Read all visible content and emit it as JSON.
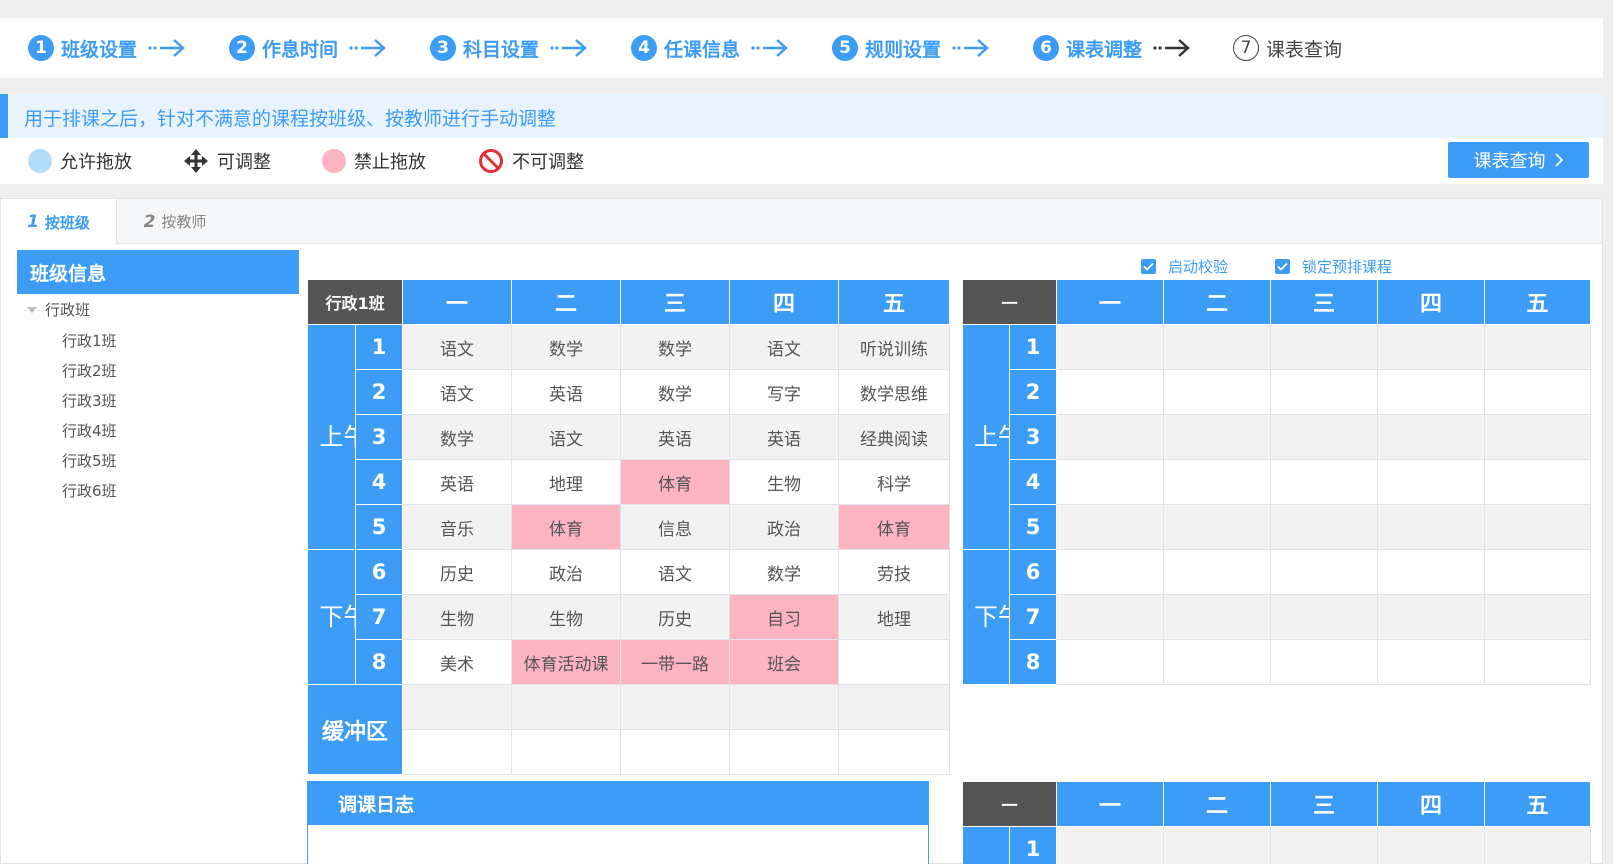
{
  "steps": [
    {
      "num": "1",
      "label": "班级设置"
    },
    {
      "num": "2",
      "label": "作息时间"
    },
    {
      "num": "3",
      "label": "科目设置"
    },
    {
      "num": "4",
      "label": "任课信息"
    },
    {
      "num": "5",
      "label": "规则设置"
    },
    {
      "num": "6",
      "label": "课表调整"
    },
    {
      "num": "7",
      "label": "课表查询"
    }
  ],
  "info_text": "用于排课之后，针对不满意的课程按班级、按教师进行手动调整",
  "legend": {
    "allow_drop": "允许拖放",
    "adjustable": "可调整",
    "no_drop": "禁止拖放",
    "not_adjustable": "不可调整"
  },
  "query_button": "课表查询",
  "tabs": [
    {
      "num": "1",
      "label": "按班级"
    },
    {
      "num": "2",
      "label": "按教师"
    }
  ],
  "sidebar": {
    "title": "班级信息",
    "root": "行政班",
    "items": [
      "行政1班",
      "行政2班",
      "行政3班",
      "行政4班",
      "行政5班",
      "行政6班"
    ]
  },
  "checkboxes": {
    "start_check": "启动校验",
    "lock_preset": "锁定预排课程"
  },
  "schedule": {
    "class_name": "行政1班",
    "days": [
      "一",
      "二",
      "三",
      "四",
      "五"
    ],
    "morning": "上午",
    "afternoon": "下午",
    "buffer": "缓冲区",
    "periods": [
      "1",
      "2",
      "3",
      "4",
      "5",
      "6",
      "7",
      "8"
    ],
    "rows": [
      [
        "语文",
        "数学",
        "数学",
        "语文",
        "听说训练"
      ],
      [
        "语文",
        "英语",
        "数学",
        "写字",
        "数学思维"
      ],
      [
        "数学",
        "语文",
        "英语",
        "英语",
        "经典阅读"
      ],
      [
        "英语",
        "地理",
        "体育",
        "生物",
        "科学"
      ],
      [
        "音乐",
        "体育",
        "信息",
        "政治",
        "体育"
      ],
      [
        "历史",
        "政治",
        "语文",
        "数学",
        "劳技"
      ],
      [
        "生物",
        "生物",
        "历史",
        "自习",
        "地理"
      ],
      [
        "美术",
        "体育活动课",
        "一带一路",
        "班会",
        ""
      ]
    ],
    "no_drop_cells": [
      [
        3,
        2
      ],
      [
        4,
        1
      ],
      [
        4,
        4
      ],
      [
        6,
        3
      ],
      [
        7,
        1
      ],
      [
        7,
        2
      ],
      [
        7,
        3
      ]
    ]
  },
  "teacher_schedule": {
    "corner": "一",
    "days": [
      "一",
      "二",
      "三",
      "四",
      "五"
    ],
    "morning": "上午",
    "afternoon": "下午",
    "periods": [
      "1",
      "2",
      "3",
      "4",
      "5",
      "6",
      "7",
      "8"
    ]
  },
  "log": {
    "title": "调课日志"
  },
  "bottom_table": {
    "corner": "一",
    "days": [
      "一",
      "二",
      "三",
      "四",
      "五"
    ],
    "first_period": "1"
  },
  "colors": {
    "accent": "#3d9cf5",
    "no_drop": "#fcb4c0",
    "allow_drop": "#b3dcfb",
    "corner": "#555555",
    "not_adjustable": "#e0303a"
  }
}
